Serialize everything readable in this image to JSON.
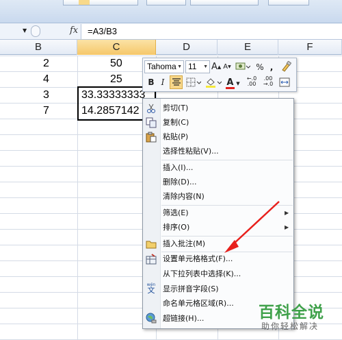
{
  "formula_bar": {
    "fx": "fx",
    "formula": "=A3/B3"
  },
  "columns": [
    {
      "label": "B",
      "selected": false
    },
    {
      "label": "C",
      "selected": true
    },
    {
      "label": "D",
      "selected": false
    },
    {
      "label": "E",
      "selected": false
    },
    {
      "label": "F",
      "selected": false
    }
  ],
  "cells": {
    "b1": "2",
    "b2": "4",
    "b3": "3",
    "b4": "7",
    "c1": "50",
    "c2": "25",
    "c3": "33.33333333",
    "c4": "14.2857142"
  },
  "mini_toolbar": {
    "font": "Tahoma",
    "size": "11",
    "grow": "A",
    "shrink": "A",
    "percent": "%",
    "comma": ",",
    "bold": "B",
    "italic": "I",
    "font_color": "A",
    "inc_decimal_top": "←.0",
    "inc_decimal_bottom": ".00",
    "dec_decimal_top": ".00",
    "dec_decimal_bottom": "→.0"
  },
  "context_menu": {
    "cut": "剪切(T)",
    "copy": "复制(C)",
    "paste": "粘贴(P)",
    "paste_special": "选择性粘贴(V)...",
    "insert": "插入(I)...",
    "delete": "删除(D)...",
    "clear_contents": "清除内容(N)",
    "filter": "筛选(E)",
    "sort": "排序(O)",
    "insert_comment": "插入批注(M)",
    "format_cells": "设置单元格格式(F)...",
    "pick_from_list": "从下拉列表中选择(K)...",
    "show_phonetic": "显示拼音字段(S)",
    "define_name": "命名单元格区域(R)...",
    "hyperlink": "超链接(H)...",
    "phonetic_icon_top": "wén",
    "phonetic_icon_char": "文"
  },
  "watermark": {
    "title": "百科全说",
    "subtitle": "助你轻松解决"
  },
  "colors": {
    "selected_header": "#f5c76a",
    "arrow": "#e8201c",
    "watermark": "#3fa14a"
  }
}
